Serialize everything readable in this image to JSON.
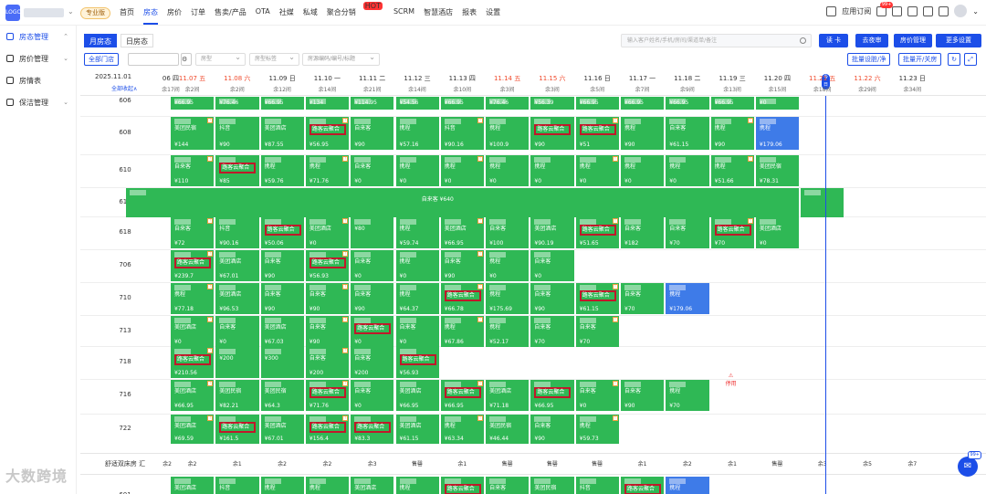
{
  "top": {
    "pro_badge": "专业版",
    "nav": [
      "首页",
      "房态",
      "房价",
      "订单",
      "售卖/产品",
      "OTA",
      "社媒",
      "私域",
      "聚合分销",
      "SCRM",
      "智慧酒店",
      "报表",
      "设置"
    ],
    "hot": "HOT",
    "app_store": "应用订阅",
    "notif_count": "99+"
  },
  "sidebar": {
    "items": [
      "房态管理",
      "房价管理",
      "房情表",
      "保洁管理"
    ]
  },
  "toolbar": {
    "tab_month": "月房态",
    "tab_day": "日房态",
    "search_placeholder": "输入客户姓名/手机/房间/渠道单/备注",
    "btn_ci": "读 卡",
    "btn_night": "去夜审",
    "btn_price": "房价管理",
    "btn_more": "更多设置",
    "all_stores": "全部门店",
    "sel_type": "房型",
    "sel_tag": "房型标签",
    "room_search_placeholder": "房源编码/编号/标题",
    "btn_batch_dirty": "批量设脏/净",
    "btn_batch_open": "批量开/关房"
  },
  "header": {
    "current": "2025.11.01",
    "collapse": "全部收起∧",
    "today": "今日"
  },
  "dates": [
    {
      "label": "06 四",
      "rem": "余17间",
      "we": false
    },
    {
      "label": "11.07 五",
      "rem": "余2间",
      "we": true
    },
    {
      "label": "11.08 六",
      "rem": "余2间",
      "we": true
    },
    {
      "label": "11.09 日",
      "rem": "余12间",
      "we": false
    },
    {
      "label": "11.10 一",
      "rem": "余14间",
      "we": false
    },
    {
      "label": "11.11 二",
      "rem": "余21间",
      "we": false
    },
    {
      "label": "11.12 三",
      "rem": "余14间",
      "we": false
    },
    {
      "label": "11.13 四",
      "rem": "余10间",
      "we": false
    },
    {
      "label": "11.14 五",
      "rem": "余3间",
      "we": true
    },
    {
      "label": "11.15 六",
      "rem": "余3间",
      "we": true
    },
    {
      "label": "11.16 日",
      "rem": "余5间",
      "we": false
    },
    {
      "label": "11.17 一",
      "rem": "余7间",
      "we": false
    },
    {
      "label": "11.18 二",
      "rem": "余9间",
      "we": false
    },
    {
      "label": "11.19 三",
      "rem": "余13间",
      "we": false
    },
    {
      "label": "11.20 四",
      "rem": "余15间",
      "we": false
    },
    {
      "label": "11.21 五",
      "rem": "余18间",
      "we": true
    },
    {
      "label": "11.22 六",
      "rem": "余29间",
      "we": true
    },
    {
      "label": "11.23 日",
      "rem": "余34间",
      "we": false
    }
  ],
  "rooms": [
    "608",
    "610",
    "616",
    "618",
    "706",
    "710",
    "713",
    "718",
    "716",
    "722"
  ],
  "room_partial_top": "606",
  "sum_label": "舒适双床房 汇",
  "sum_values": [
    "余2",
    "余2",
    "余1",
    "余2",
    "余2",
    "余3",
    "售罄",
    "余1",
    "售罄",
    "售罄",
    "售罄",
    "余1",
    "余2",
    "余1",
    "售罄",
    "余3",
    "余5",
    "余7"
  ],
  "bottom_room": "601",
  "stopped": "停用",
  "watermark": "大数跨境",
  "chat_count": "99+",
  "cells": {
    "r0": [
      [
        "",
        "¥66.95",
        0
      ],
      [
        "",
        "¥76.46",
        0
      ],
      [
        "",
        "¥66.95",
        0
      ],
      [
        "",
        "¥134",
        0
      ],
      [
        "",
        "¥114.95",
        0
      ],
      [
        "",
        "¥54.56",
        0
      ],
      [
        "",
        "¥66.95",
        0
      ],
      [
        "",
        "¥76.46",
        0
      ],
      [
        "",
        "¥56.39",
        0
      ],
      [
        "",
        "¥66.95",
        0
      ],
      [
        "",
        "¥66.95",
        0
      ],
      [
        "",
        "¥66.95",
        0
      ],
      [
        "",
        "¥66.95",
        0
      ],
      [
        "",
        "¥0",
        0
      ]
    ],
    "r608": [
      [
        "美团民宿",
        "¥144"
      ],
      [
        "抖音",
        "¥90"
      ],
      [
        "美团酒店",
        "¥87.55"
      ],
      [
        "路客云聚合",
        "¥56.95"
      ],
      [
        "自来客",
        "¥90"
      ],
      [
        "携程",
        "¥57.16"
      ],
      [
        "抖音",
        "¥90.16"
      ],
      [
        "携程",
        "¥100.9"
      ],
      [
        "路客云聚合",
        "¥90"
      ],
      [
        "路客云聚合",
        "¥51"
      ],
      [
        "携程",
        "¥90"
      ],
      [
        "自来客",
        "¥61.15"
      ],
      [
        "携程",
        "¥90"
      ],
      [
        "携程",
        "¥179.06"
      ]
    ],
    "r610": [
      [
        "自来客",
        "¥110"
      ],
      [
        "路客云聚合",
        "¥85"
      ],
      [
        "携程",
        "¥59.76"
      ],
      [
        "携程",
        "¥71.76"
      ],
      [
        "自来客",
        "¥0"
      ],
      [
        "携程",
        "¥0"
      ],
      [
        "携程",
        "¥0"
      ],
      [
        "携程",
        "¥0"
      ],
      [
        "携程",
        "¥0"
      ],
      [
        "携程",
        "¥0"
      ],
      [
        "携程",
        "¥0"
      ],
      [
        "携程",
        "¥0"
      ],
      [
        "携程",
        "¥51.66"
      ],
      [
        "美团民宿",
        "¥78.31"
      ]
    ],
    "r616": "自来客 ¥640",
    "r618": [
      [
        "自来客",
        "¥72"
      ],
      [
        "抖音",
        "¥90.16"
      ],
      [
        "路客云聚合",
        "¥50.06"
      ],
      [
        "美团酒店",
        "¥0"
      ],
      [
        "¥80",
        ""
      ],
      [
        "携程",
        "¥59.74"
      ],
      [
        "美团酒店",
        "¥66.95"
      ],
      [
        "自来客",
        "¥100"
      ],
      [
        "美团酒店",
        "¥90.19"
      ],
      [
        "路客云聚合",
        "¥51.65"
      ],
      [
        "自来客",
        "¥182"
      ],
      [
        "自来客",
        "¥70"
      ],
      [
        "路客云聚合",
        "¥70"
      ],
      [
        "美团酒店",
        "¥0"
      ]
    ],
    "r706": [
      [
        "路客云聚合",
        "¥239.7"
      ],
      [
        "美团酒店",
        "¥67.01"
      ],
      [
        "自来客",
        "¥90"
      ],
      [
        "路客云聚合",
        "¥56.93"
      ],
      [
        "自来客",
        "¥0"
      ],
      [
        "携程",
        "¥0"
      ],
      [
        "自来客",
        "¥90"
      ],
      [
        "携程",
        "¥0"
      ],
      [
        "自来客",
        "¥0"
      ]
    ],
    "r710": [
      [
        "携程",
        "¥77.18"
      ],
      [
        "美团酒店",
        "¥96.53"
      ],
      [
        "自来客",
        "¥90"
      ],
      [
        "自来客",
        "¥90"
      ],
      [
        "自来客",
        "¥90"
      ],
      [
        "携程",
        "¥64.37"
      ],
      [
        "路客云聚合",
        "¥66.78"
      ],
      [
        "携程",
        "¥175.69"
      ],
      [
        "自来客",
        "¥90"
      ],
      [
        "路客云聚合",
        "¥61.15"
      ],
      [
        "自来客",
        "¥70"
      ],
      [
        "携程",
        "¥179.06"
      ]
    ],
    "r713": [
      [
        "美团酒店",
        "¥0"
      ],
      [
        "自来客",
        "¥0"
      ],
      [
        "美团酒店",
        "¥67.03"
      ],
      [
        "自来客",
        "¥90"
      ],
      [
        "路客云聚合",
        "¥0"
      ],
      [
        "自来客",
        "¥0"
      ],
      [
        "携程",
        "¥67.86"
      ],
      [
        "携程",
        "¥52.17"
      ],
      [
        "自来客",
        "¥70"
      ],
      [
        "自来客",
        "¥70"
      ]
    ],
    "r718": [
      [
        "路客云聚合",
        "¥210.56"
      ],
      [
        "¥200",
        ""
      ],
      [
        "¥300",
        ""
      ],
      [
        "自来客",
        "¥200"
      ],
      [
        "自来客",
        "¥200"
      ],
      [
        "路客云聚合",
        "¥56.93"
      ]
    ],
    "r716": [
      [
        "美团酒店",
        "¥66.95"
      ],
      [
        "美团民宿",
        "¥82.21"
      ],
      [
        "美团民宿",
        "¥64.3"
      ],
      [
        "路客云聚合",
        "¥71.76"
      ],
      [
        "自来客",
        "¥0"
      ],
      [
        "美团酒店",
        "¥66.95"
      ],
      [
        "路客云聚合",
        "¥66.95"
      ],
      [
        "美团酒店",
        "¥71.18"
      ],
      [
        "路客云聚合",
        "¥66.95"
      ],
      [
        "自来客",
        "¥0"
      ],
      [
        "自来客",
        "¥90"
      ],
      [
        "携程",
        "¥70"
      ]
    ],
    "r722": [
      [
        "美团酒店",
        "¥69.59"
      ],
      [
        "路客云聚合",
        "¥161.5"
      ],
      [
        "美团酒店",
        "¥67.01"
      ],
      [
        "路客云聚合",
        "¥156.4"
      ],
      [
        "路客云聚合",
        "¥83.3"
      ],
      [
        "美团酒店",
        "¥61.15"
      ],
      [
        "携程",
        "¥63.34"
      ],
      [
        "美团民宿",
        "¥46.44"
      ],
      [
        "自来客",
        "¥90"
      ],
      [
        "携程",
        "¥59.73"
      ]
    ],
    "r601": [
      [
        "美团酒店",
        "¥66.95"
      ],
      [
        "抖音",
        "¥59.76"
      ],
      [
        "携程",
        "¥67.85"
      ],
      [
        "携程",
        "¥73.24"
      ],
      [
        "美团酒店",
        "¥66.07"
      ],
      [
        "携程",
        "¥53.65"
      ],
      [
        "路客云聚合",
        "¥179.05"
      ],
      [
        "自来客",
        "¥180"
      ],
      [
        "美团民宿",
        "¥39.2"
      ],
      [
        "抖音",
        "¥57.96"
      ],
      [
        "路客云聚合",
        "¥90"
      ],
      [
        "携程",
        "¥0"
      ]
    ]
  }
}
